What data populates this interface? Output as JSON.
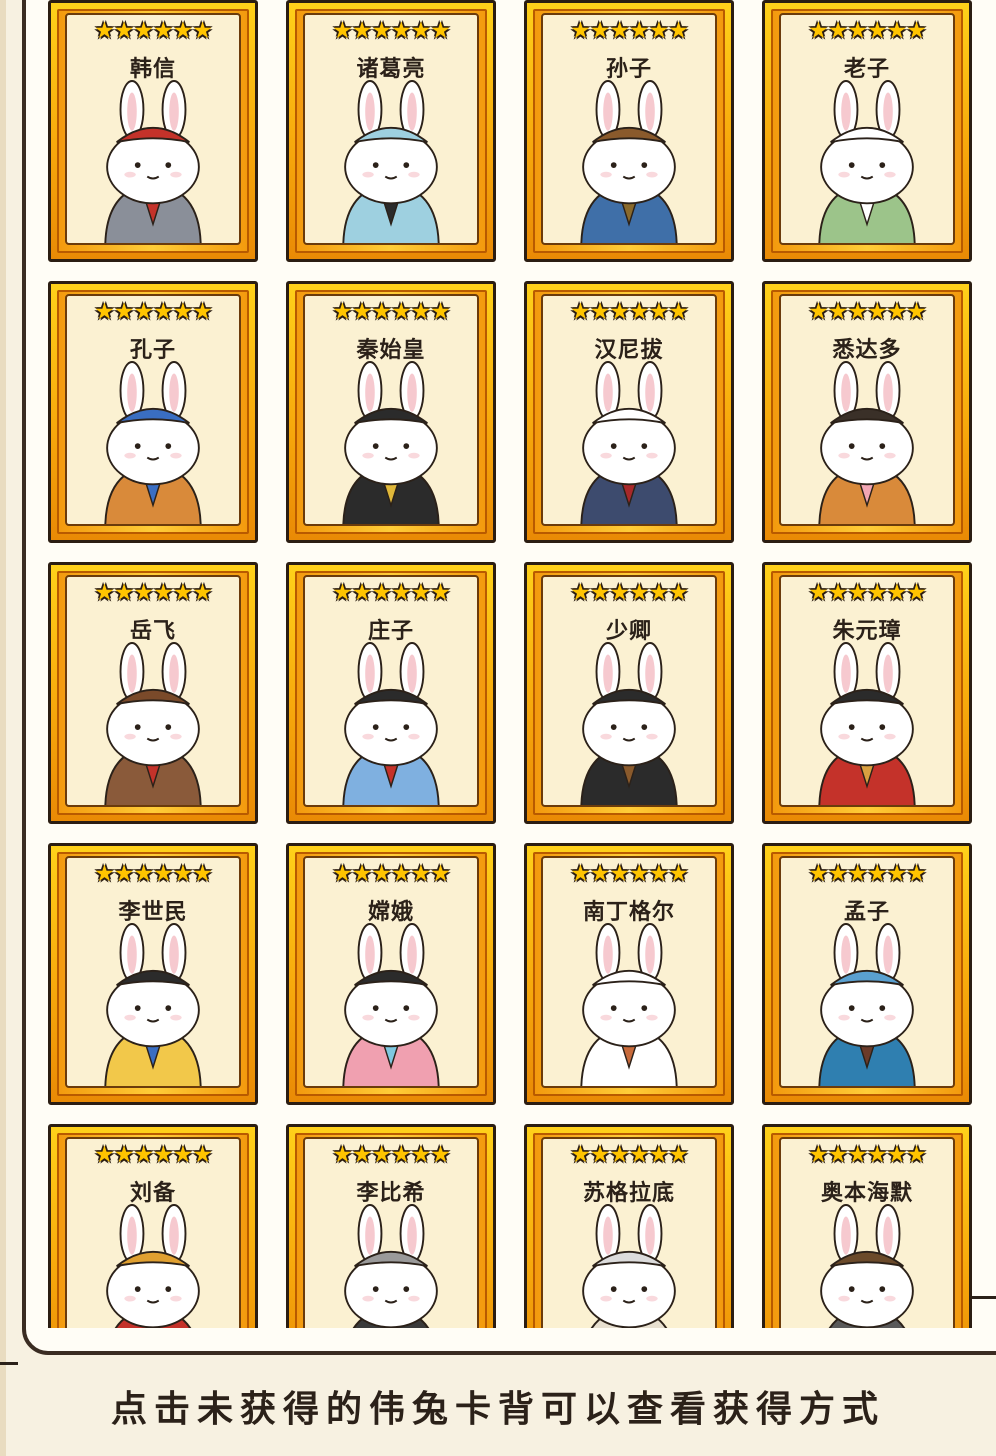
{
  "cards": [
    {
      "name": "韩信",
      "stars": "★★★★★★",
      "robe": "#8a8f99",
      "accent": "#c4322a",
      "hat": "#c4322a"
    },
    {
      "name": "诸葛亮",
      "stars": "★★★★★★",
      "robe": "#9ed0e0",
      "accent": "#2b2b2b",
      "hat": "#9ed0e0"
    },
    {
      "name": "孙子",
      "stars": "★★★★★★",
      "robe": "#3f6fa8",
      "accent": "#8a6a2c",
      "hat": "#8a5a2c"
    },
    {
      "name": "老子",
      "stars": "★★★★★★",
      "robe": "#9cc48a",
      "accent": "#ffffff",
      "hat": "#ffffff"
    },
    {
      "name": "孔子",
      "stars": "★★★★★★",
      "robe": "#d98a3a",
      "accent": "#3a6ec2",
      "hat": "#3a6ec2"
    },
    {
      "name": "秦始皇",
      "stars": "★★★★★★",
      "robe": "#2b2b2b",
      "accent": "#e0b83a",
      "hat": "#2b2b2b"
    },
    {
      "name": "汉尼拔",
      "stars": "★★★★★★",
      "robe": "#3d4b6e",
      "accent": "#a8282a",
      "hat": "#ffffff"
    },
    {
      "name": "悉达多",
      "stars": "★★★★★★",
      "robe": "#d98a3a",
      "accent": "#f2a6b4",
      "hat": "#3a3028"
    },
    {
      "name": "岳飞",
      "stars": "★★★★★★",
      "robe": "#8a5a3a",
      "accent": "#c4322a",
      "hat": "#7a4a2a"
    },
    {
      "name": "庄子",
      "stars": "★★★★★★",
      "robe": "#7fb0e0",
      "accent": "#c4322a",
      "hat": "#2b2b2b"
    },
    {
      "name": "少卿",
      "stars": "★★★★★★",
      "robe": "#2b2b2b",
      "accent": "#8a5a2c",
      "hat": "#2b2b2b"
    },
    {
      "name": "朱元璋",
      "stars": "★★★★★★",
      "robe": "#c4322a",
      "accent": "#d9a040",
      "hat": "#2b2b2b"
    },
    {
      "name": "李世民",
      "stars": "★★★★★★",
      "robe": "#f2c84a",
      "accent": "#3a6ec2",
      "hat": "#2b2b2b"
    },
    {
      "name": "嫦娥",
      "stars": "★★★★★★",
      "robe": "#f0a0b0",
      "accent": "#7fc8e0",
      "hat": "#2b2b2b"
    },
    {
      "name": "南丁格尔",
      "stars": "★★★★★★",
      "robe": "#ffffff",
      "accent": "#c86a3a",
      "hat": "#ffffff"
    },
    {
      "name": "孟子",
      "stars": "★★★★★★",
      "robe": "#2f7fb0",
      "accent": "#6b3b2a",
      "hat": "#5aa0d0"
    },
    {
      "name": "刘备",
      "stars": "★★★★★★",
      "robe": "#c4322a",
      "accent": "#e0a030",
      "hat": "#e0a030"
    },
    {
      "name": "李比希",
      "stars": "★★★★★★",
      "robe": "#3a3a3a",
      "accent": "#8a6a4a",
      "hat": "#9a9a9a"
    },
    {
      "name": "苏格拉底",
      "stars": "★★★★★★",
      "robe": "#e8e0d0",
      "accent": "#a89a7a",
      "hat": "#dcdcdc"
    },
    {
      "name": "奥本海默",
      "stars": "★★★★★★",
      "robe": "#5a5a5a",
      "accent": "#3a8ad0",
      "hat": "#6b4a2a"
    }
  ],
  "footer": {
    "hint": "点击未获得的伟兔卡背可以查看获得方式"
  }
}
